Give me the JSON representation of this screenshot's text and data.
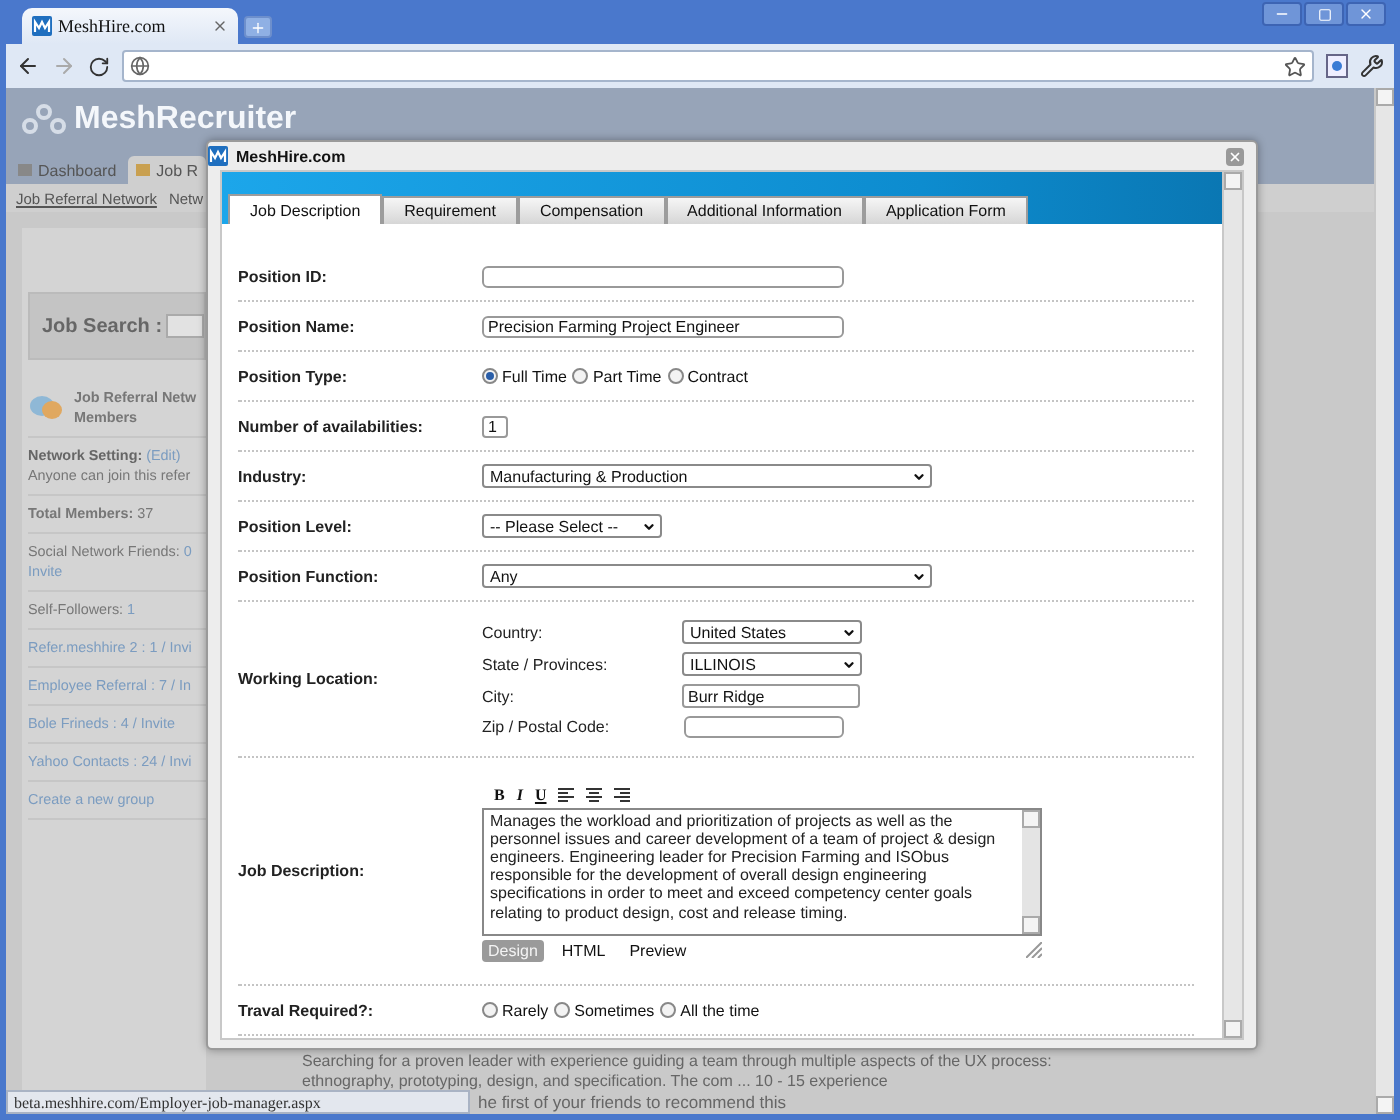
{
  "browser": {
    "tab_title": "MeshHire.com"
  },
  "background_page": {
    "logo": "MeshRecruiter",
    "nav_tabs": [
      {
        "label": "Dashboard",
        "selected": false
      },
      {
        "label": "Job R",
        "selected": true
      }
    ],
    "subnav": [
      {
        "label": "Job Referral Network",
        "selected": true
      },
      {
        "label": "Netw",
        "selected": false
      }
    ],
    "search_label": "Job Search :",
    "network_title": [
      "Job Referral Netw",
      "Members"
    ],
    "network_items": [
      {
        "kind": "setting",
        "label": "Network Setting:",
        "link": "(Edit)",
        "note": "Anyone can join this refer"
      },
      {
        "kind": "total",
        "text": "**Total Members:** 37"
      },
      {
        "kind": "count",
        "label": "Social Network Friends:",
        "value": "0",
        "link": "Invite"
      },
      {
        "kind": "count",
        "label": "Self-Followers:",
        "value": "1"
      },
      {
        "kind": "link",
        "text": "Refer.meshhire 2 : 1 / Invi"
      },
      {
        "kind": "link",
        "text": "Employee Referral : 7 / In"
      },
      {
        "kind": "link",
        "text": "Bole Frineds : 4 / Invite"
      },
      {
        "kind": "link",
        "text": "Yahoo Contacts : 24 / Invi"
      },
      {
        "kind": "link",
        "text": "Create a new group"
      }
    ],
    "job_snippet": "Searching for a proven leader with experience guiding a team through multiple aspects of the UX process: ethnography, prototyping, design, and specification. The com ... 10 - 15 experience",
    "recommend_line": "he first of your friends to recommend this"
  },
  "modal": {
    "title": "MeshHire.com",
    "tabs": [
      {
        "label": "Job Description",
        "selected": true
      },
      {
        "label": "Requirement",
        "selected": false
      },
      {
        "label": "Compensation",
        "selected": false
      },
      {
        "label": "Additional Information",
        "selected": false
      },
      {
        "label": "Application Form",
        "selected": false
      }
    ],
    "form": [
      {
        "kind": "text",
        "label": "Position ID:"
      },
      {
        "kind": "text",
        "label": "Position Name:",
        "value": "Precision Farming Project Engineer"
      },
      {
        "kind": "radio",
        "label": "Position Type:",
        "options": [
          {
            "label": "Full Time",
            "selected": true
          },
          {
            "label": "Part Time",
            "selected": false
          },
          {
            "label": "Contract",
            "selected": false
          }
        ]
      },
      {
        "kind": "number",
        "label": "Number of availabilities:",
        "value": "1"
      },
      {
        "kind": "select",
        "label": "Industry:",
        "value": "Manufacturing & Production"
      },
      {
        "kind": "short_select",
        "label": "Position Level:",
        "value": "-- Please Select --"
      },
      {
        "kind": "select",
        "label": "Position Function:",
        "value": "Any"
      },
      {
        "kind": "location",
        "label": "Working Location:",
        "fields": [
          {
            "kind": "select",
            "label": "Country:",
            "value": "United States"
          },
          {
            "kind": "select",
            "label": "State / Provinces:",
            "value": "ILLINOIS"
          },
          {
            "kind": "text",
            "label": "City:",
            "value": "Burr Ridge"
          },
          {
            "kind": "text",
            "label": "Zip / Postal Code:"
          }
        ]
      },
      {
        "kind": "editor",
        "label": "Job Description:",
        "format_buttons": [
          "B",
          "I",
          "U"
        ],
        "value": "Manages the workload and prioritization of projects as well as the personnel issues and career development of a team of project & design engineers. Engineering leader for Precision Farming and ISObus responsible for the development of overall design engineering specifications in order to meet and exceed competency center goals relating to product design, cost and release timing.",
        "modes": [
          {
            "label": "Design",
            "selected": true
          },
          {
            "label": "HTML",
            "selected": false
          },
          {
            "label": "Preview",
            "selected": false
          }
        ]
      },
      {
        "kind": "radio",
        "label": "Traval Required?:",
        "options": [
          {
            "label": "Rarely",
            "selected": false
          },
          {
            "label": "Sometimes",
            "selected": false
          },
          {
            "label": "All the time",
            "selected": false
          }
        ]
      }
    ]
  },
  "status_bar": "beta.meshhire.com/Employer-job-manager.aspx"
}
